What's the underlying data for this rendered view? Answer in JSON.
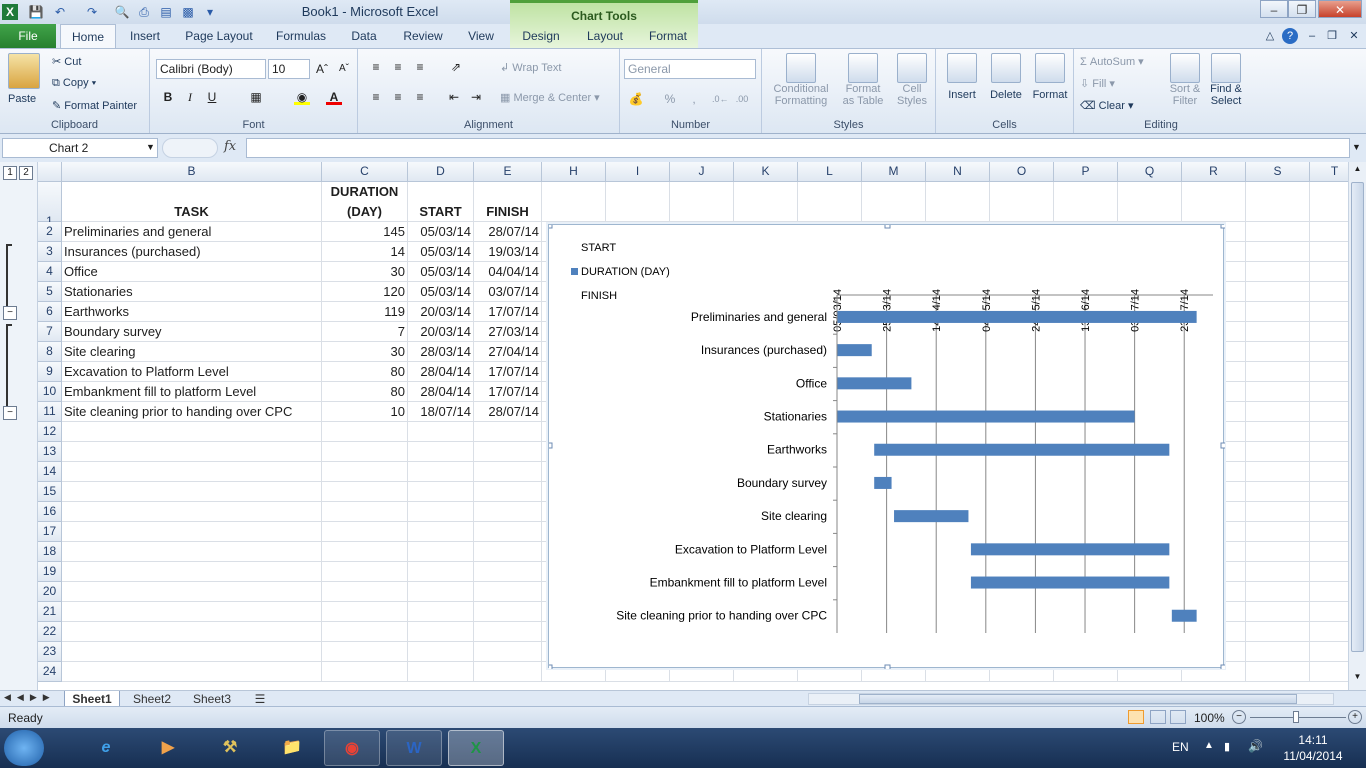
{
  "window": {
    "title": "Book1  -  Microsoft Excel",
    "context_tab_group": "Chart Tools"
  },
  "tabs": {
    "file": "File",
    "items": [
      "Home",
      "Insert",
      "Page Layout",
      "Formulas",
      "Data",
      "Review",
      "View"
    ],
    "context_items": [
      "Design",
      "Layout",
      "Format"
    ],
    "active": "Home"
  },
  "ribbon": {
    "clipboard": {
      "label": "Clipboard",
      "paste": "Paste",
      "cut": "Cut",
      "copy": "Copy",
      "format_painter": "Format Painter"
    },
    "font": {
      "label": "Font",
      "font_name": "Calibri (Body)",
      "font_size": "10",
      "bold": "B",
      "italic": "I",
      "underline": "U"
    },
    "alignment": {
      "label": "Alignment",
      "wrap_text": "Wrap Text",
      "merge_center": "Merge & Center"
    },
    "number": {
      "label": "Number",
      "format": "General",
      "percent": "%",
      "comma": ","
    },
    "styles": {
      "label": "Styles",
      "conditional": "Conditional",
      "conditional2": "Formatting",
      "format_as": "Format",
      "format_as2": "as Table",
      "cell": "Cell",
      "cell2": "Styles"
    },
    "cells": {
      "label": "Cells",
      "insert": "Insert",
      "delete": "Delete",
      "format": "Format"
    },
    "editing": {
      "label": "Editing",
      "autosum": "AutoSum",
      "fill": "Fill",
      "clear": "Clear",
      "sort": "Sort &",
      "sort2": "Filter",
      "find": "Find &",
      "find2": "Select"
    }
  },
  "formula_bar": {
    "name_box": "Chart 2",
    "fx": "fx",
    "formula": ""
  },
  "sheet": {
    "columns": [
      "B",
      "C",
      "D",
      "E",
      "H",
      "I",
      "J",
      "K",
      "L",
      "M",
      "N",
      "O",
      "P",
      "Q",
      "R",
      "S",
      "T"
    ],
    "row_numbers": [
      "1",
      "2",
      "3",
      "4",
      "5",
      "6",
      "7",
      "8",
      "9",
      "10",
      "11",
      "12",
      "13",
      "14",
      "15",
      "16",
      "17",
      "18",
      "19",
      "20",
      "21",
      "22",
      "23",
      "24"
    ],
    "outline_levels": [
      "1",
      "2"
    ],
    "headers": {
      "task": "TASK",
      "duration_line1": "DURATION",
      "duration_line2": "(DAY)",
      "start": "START",
      "finish": "FINISH"
    },
    "rows": [
      {
        "task": "Preliminaries and general",
        "duration": "145",
        "start": "05/03/14",
        "finish": "28/07/14"
      },
      {
        "task": "Insurances (purchased)",
        "duration": "14",
        "start": "05/03/14",
        "finish": "19/03/14"
      },
      {
        "task": "Office",
        "duration": "30",
        "start": "05/03/14",
        "finish": "04/04/14"
      },
      {
        "task": "Stationaries",
        "duration": "120",
        "start": "05/03/14",
        "finish": "03/07/14"
      },
      {
        "task": "Earthworks",
        "duration": "119",
        "start": "20/03/14",
        "finish": "17/07/14"
      },
      {
        "task": "Boundary survey",
        "duration": "7",
        "start": "20/03/14",
        "finish": "27/03/14"
      },
      {
        "task": "Site clearing",
        "duration": "30",
        "start": "28/03/14",
        "finish": "27/04/14"
      },
      {
        "task": "Excavation to Platform Level",
        "duration": "80",
        "start": "28/04/14",
        "finish": "17/07/14"
      },
      {
        "task": "Embankment fill to platform Level",
        "duration": "80",
        "start": "28/04/14",
        "finish": "17/07/14"
      },
      {
        "task": "Site cleaning prior to handing over CPC",
        "duration": "10",
        "start": "18/07/14",
        "finish": "28/07/14"
      }
    ],
    "sheet_tabs": [
      "Sheet1",
      "Sheet2",
      "Sheet3"
    ],
    "active_sheet": "Sheet1"
  },
  "chart_data": {
    "type": "bar",
    "orientation": "horizontal-gantt",
    "legend": [
      "START",
      "DURATION (DAY)",
      "FINISH"
    ],
    "legend_position": "top-left",
    "categories": [
      "Preliminaries and general",
      "Insurances (purchased)",
      "Office",
      "Stationaries",
      "Earthworks",
      "Boundary survey",
      "Site clearing",
      "Excavation to Platform Level",
      "Embankment fill to platform Level",
      "Site cleaning prior to handing over CPC"
    ],
    "series": [
      {
        "name": "START",
        "values": [
          "05/03/14",
          "05/03/14",
          "05/03/14",
          "05/03/14",
          "20/03/14",
          "20/03/14",
          "28/03/14",
          "28/04/14",
          "28/04/14",
          "18/07/14"
        ],
        "visible": false
      },
      {
        "name": "DURATION (DAY)",
        "values": [
          145,
          14,
          30,
          120,
          119,
          7,
          30,
          80,
          80,
          10
        ],
        "color": "#4f81bd"
      }
    ],
    "x_ticks": [
      "05/03/14",
      "25/03/14",
      "14/04/14",
      "04/05/14",
      "24/05/14",
      "13/06/14",
      "03/07/14",
      "23/07/14"
    ],
    "x_axis_position": "top",
    "grid": true
  },
  "status": {
    "ready": "Ready",
    "zoom": "100%"
  },
  "taskbar": {
    "lang": "EN",
    "time": "14:11",
    "date": "11/04/2014"
  }
}
